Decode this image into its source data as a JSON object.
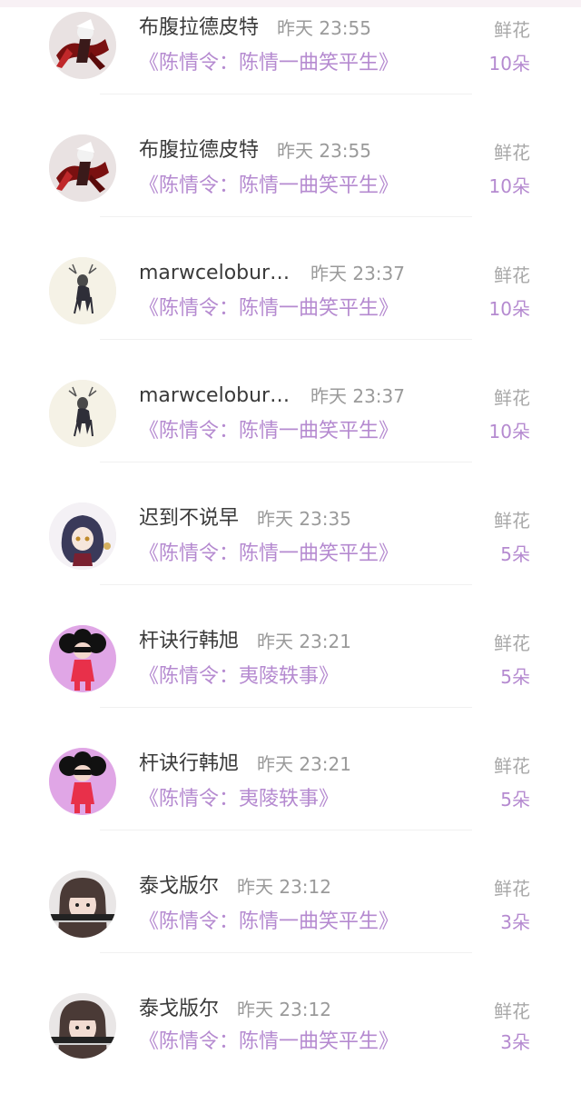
{
  "records": [
    {
      "name": "布腹拉德皮特",
      "time": "昨天 23:55",
      "book": "《陈情令：陈情一曲笑平生》",
      "gift_label": "鲜花",
      "gift_count": "10朵",
      "avatar": "red-warrior-avatar"
    },
    {
      "name": "布腹拉德皮特",
      "time": "昨天 23:55",
      "book": "《陈情令：陈情一曲笑平生》",
      "gift_label": "鲜花",
      "gift_count": "10朵",
      "avatar": "red-warrior-avatar"
    },
    {
      "name": "marwceloburlo...",
      "time": "昨天 23:37",
      "book": "《陈情令：陈情一曲笑平生》",
      "gift_label": "鲜花",
      "gift_count": "10朵",
      "avatar": "deer-avatar"
    },
    {
      "name": "marwceloburlo...",
      "time": "昨天 23:37",
      "book": "《陈情令：陈情一曲笑平生》",
      "gift_label": "鲜花",
      "gift_count": "10朵",
      "avatar": "deer-avatar"
    },
    {
      "name": "迟到不说早",
      "time": "昨天 23:35",
      "book": "《陈情令：陈情一曲笑平生》",
      "gift_label": "鲜花",
      "gift_count": "5朵",
      "avatar": "hooded-girl-avatar"
    },
    {
      "name": "杆诀行韩旭",
      "time": "昨天 23:21",
      "book": "《陈情令：夷陵轶事》",
      "gift_label": "鲜花",
      "gift_count": "5朵",
      "avatar": "cartoon-girl-avatar"
    },
    {
      "name": "杆诀行韩旭",
      "time": "昨天 23:21",
      "book": "《陈情令：夷陵轶事》",
      "gift_label": "鲜花",
      "gift_count": "5朵",
      "avatar": "cartoon-girl-avatar"
    },
    {
      "name": "泰戈版尔",
      "time": "昨天 23:12",
      "book": "《陈情令：陈情一曲笑平生》",
      "gift_label": "鲜花",
      "gift_count": "3朵",
      "avatar": "portrait-avatar"
    },
    {
      "name": "泰戈版尔",
      "time": "昨天 23:12",
      "book": "《陈情令：陈情一曲笑平生》",
      "gift_label": "鲜花",
      "gift_count": "3朵",
      "avatar": "portrait-avatar"
    }
  ]
}
